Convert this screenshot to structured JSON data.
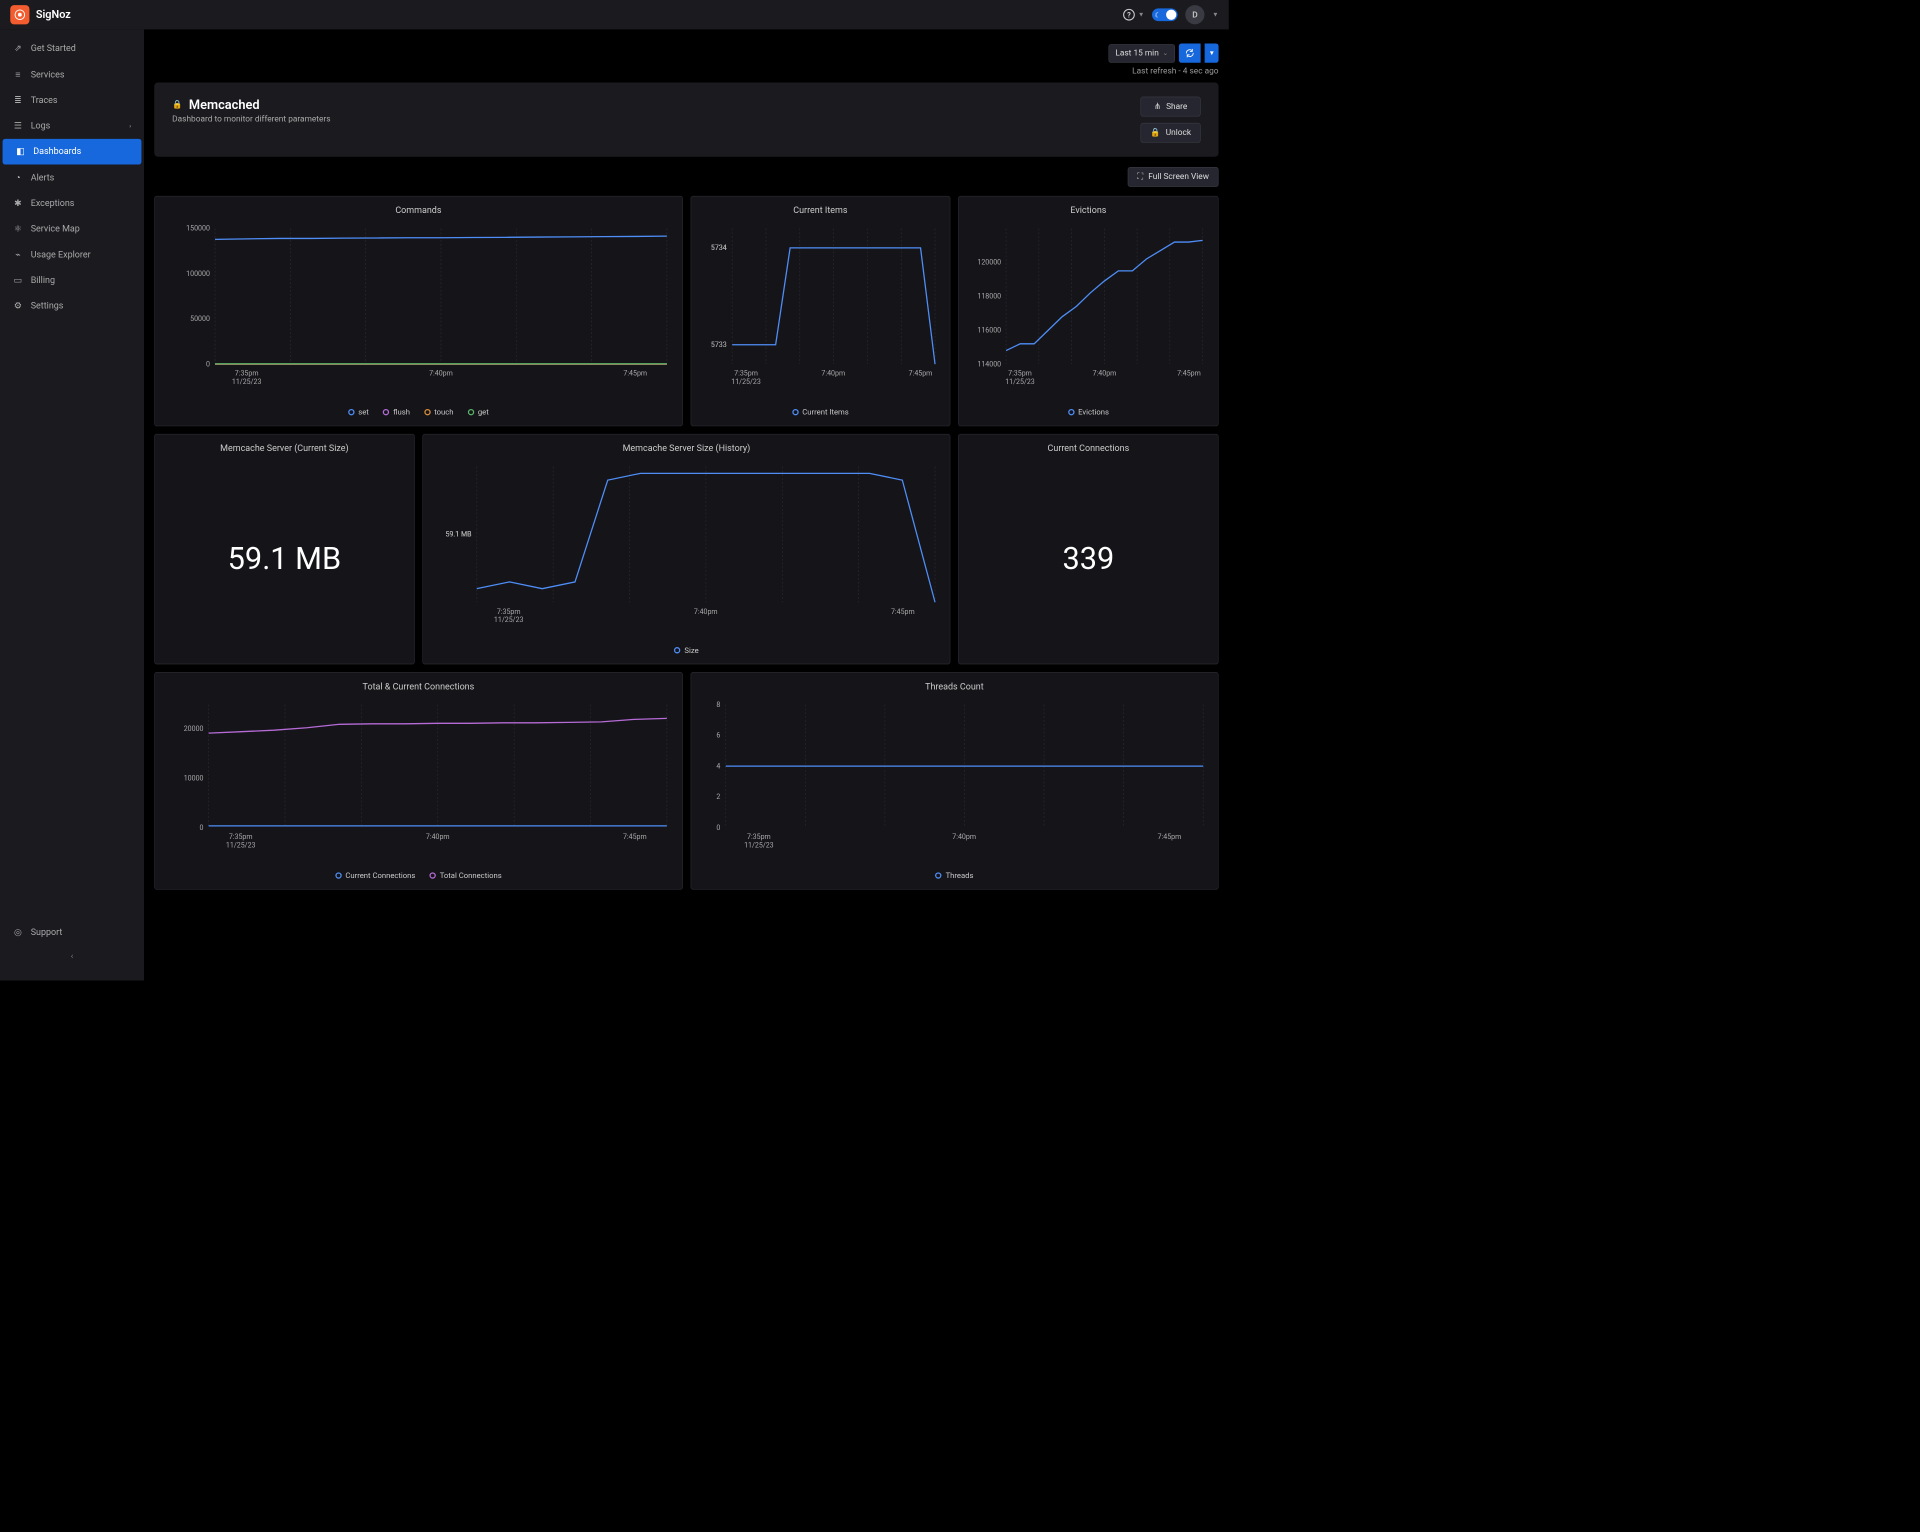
{
  "brand": {
    "name": "SigNoz"
  },
  "header": {
    "avatar_initial": "D"
  },
  "sidebar": {
    "items": [
      {
        "label": "Get Started",
        "icon": "rocket"
      },
      {
        "label": "Services",
        "icon": "bars"
      },
      {
        "label": "Traces",
        "icon": "lines"
      },
      {
        "label": "Logs",
        "icon": "list",
        "expandable": true
      },
      {
        "label": "Dashboards",
        "icon": "dashboard",
        "active": true
      },
      {
        "label": "Alerts",
        "icon": "bell"
      },
      {
        "label": "Exceptions",
        "icon": "bug"
      },
      {
        "label": "Service Map",
        "icon": "graph"
      },
      {
        "label": "Usage Explorer",
        "icon": "chart"
      },
      {
        "label": "Billing",
        "icon": "card"
      },
      {
        "label": "Settings",
        "icon": "gear"
      }
    ],
    "support_label": "Support"
  },
  "toolbar": {
    "time_range": "Last 15 min",
    "last_refresh": "Last refresh - 4 sec ago"
  },
  "dashboard": {
    "title": "Memcached",
    "description": "Dashboard to monitor different parameters",
    "share_label": "Share",
    "unlock_label": "Unlock",
    "fullscreen_label": "Full Screen View"
  },
  "panels": {
    "commands": {
      "title": "Commands",
      "legend": [
        "set",
        "flush",
        "touch",
        "get"
      ]
    },
    "current_items": {
      "title": "Current Items",
      "legend": [
        "Current Items"
      ]
    },
    "evictions": {
      "title": "Evictions",
      "legend": [
        "Evictions"
      ]
    },
    "server_size": {
      "title": "Memcache Server (Current Size)",
      "value": "59.1 MB"
    },
    "server_size_history": {
      "title": "Memcache Server Size (History)",
      "legend": [
        "Size"
      ]
    },
    "current_connections": {
      "title": "Current Connections",
      "value": "339"
    },
    "total_connections": {
      "title": "Total & Current Connections",
      "legend": [
        "Current Connections",
        "Total Connections"
      ]
    },
    "threads": {
      "title": "Threads Count",
      "legend": [
        "Threads"
      ]
    }
  },
  "chart_data": [
    {
      "id": "commands",
      "type": "line",
      "title": "Commands",
      "xlabel": "",
      "ylabel": "",
      "ylim": [
        0,
        150000
      ],
      "yticks": [
        0,
        50000,
        100000,
        150000
      ],
      "xticks": [
        "7:35pm\n11/25/23",
        "7:40pm",
        "7:45pm"
      ],
      "x": [
        0,
        1,
        2,
        3,
        4,
        5,
        6,
        7,
        8,
        9,
        10,
        11,
        12,
        13,
        14
      ],
      "series": [
        {
          "name": "set",
          "color": "#4f8ef7",
          "values": [
            138000,
            138500,
            139000,
            139000,
            139300,
            139500,
            139700,
            139800,
            140000,
            140200,
            140500,
            140700,
            141000,
            141200,
            141500
          ]
        },
        {
          "name": "flush",
          "color": "#b66bd6",
          "values": [
            0,
            0,
            0,
            0,
            0,
            0,
            0,
            0,
            0,
            0,
            0,
            0,
            0,
            0,
            0
          ]
        },
        {
          "name": "touch",
          "color": "#d98f3e",
          "values": [
            0,
            0,
            0,
            0,
            0,
            0,
            0,
            0,
            0,
            0,
            0,
            0,
            0,
            0,
            0
          ]
        },
        {
          "name": "get",
          "color": "#5bb36a",
          "values": [
            500,
            500,
            500,
            500,
            500,
            500,
            500,
            500,
            500,
            500,
            500,
            500,
            500,
            500,
            500
          ]
        }
      ]
    },
    {
      "id": "current_items",
      "type": "line",
      "title": "Current Items",
      "ylim": [
        5732.8,
        5734.2
      ],
      "yticks": [
        5733,
        5733,
        5734,
        5734,
        5734
      ],
      "ytick_labels": [
        "5733",
        "5733",
        "5734",
        "5734",
        "5734"
      ],
      "xticks": [
        "7:35pm\n11/25/23",
        "7:40pm",
        "7:45pm"
      ],
      "x": [
        0,
        1,
        2,
        3,
        4,
        5,
        6,
        7,
        8,
        9,
        10,
        11,
        12,
        13,
        14
      ],
      "series": [
        {
          "name": "Current Items",
          "color": "#4f8ef7",
          "values": [
            5733,
            5733,
            5733,
            5733,
            5734,
            5734,
            5734,
            5734,
            5734,
            5734,
            5734,
            5734,
            5734,
            5734,
            5732.8
          ]
        }
      ]
    },
    {
      "id": "evictions",
      "type": "line",
      "title": "Evictions",
      "ylim": [
        114000,
        122000
      ],
      "yticks": [
        114000,
        116000,
        118000,
        120000
      ],
      "xticks": [
        "7:35pm\n11/25/23",
        "7:40pm",
        "7:45pm"
      ],
      "x": [
        0,
        1,
        2,
        3,
        4,
        5,
        6,
        7,
        8,
        9,
        10,
        11,
        12,
        13,
        14
      ],
      "series": [
        {
          "name": "Evictions",
          "color": "#4f8ef7",
          "values": [
            114800,
            115200,
            115200,
            116000,
            116800,
            117400,
            118200,
            118900,
            119500,
            119500,
            120200,
            120700,
            121200,
            121200,
            121300
          ]
        }
      ]
    },
    {
      "id": "server_size_history",
      "type": "line",
      "title": "Memcache Server Size (History)",
      "ylim": [
        59.05,
        59.15
      ],
      "yticks": [
        59.1,
        59.1,
        59.1
      ],
      "ytick_labels": [
        "59.1 MB",
        "59.1 MB",
        "59.1 MB"
      ],
      "xticks": [
        "7:35pm\n11/25/23",
        "7:40pm",
        "7:45pm"
      ],
      "x": [
        0,
        1,
        2,
        3,
        4,
        5,
        6,
        7,
        8,
        9,
        10,
        11,
        12,
        13,
        14
      ],
      "series": [
        {
          "name": "Size",
          "color": "#4f8ef7",
          "values": [
            59.06,
            59.065,
            59.06,
            59.065,
            59.14,
            59.145,
            59.145,
            59.145,
            59.145,
            59.145,
            59.145,
            59.145,
            59.145,
            59.14,
            59.05
          ]
        }
      ]
    },
    {
      "id": "total_connections",
      "type": "line",
      "title": "Total & Current Connections",
      "ylim": [
        0,
        25000
      ],
      "yticks": [
        0,
        10000,
        20000
      ],
      "xticks": [
        "7:35pm\n11/25/23",
        "7:40pm",
        "7:45pm"
      ],
      "x": [
        0,
        1,
        2,
        3,
        4,
        5,
        6,
        7,
        8,
        9,
        10,
        11,
        12,
        13,
        14
      ],
      "series": [
        {
          "name": "Current Connections",
          "color": "#4f8ef7",
          "values": [
            339,
            339,
            339,
            339,
            339,
            339,
            339,
            339,
            339,
            339,
            339,
            339,
            339,
            339,
            339
          ]
        },
        {
          "name": "Total Connections",
          "color": "#b66bd6",
          "values": [
            19200,
            19500,
            19800,
            20300,
            21000,
            21100,
            21100,
            21200,
            21200,
            21300,
            21300,
            21400,
            21500,
            22000,
            22200
          ]
        }
      ]
    },
    {
      "id": "threads",
      "type": "line",
      "title": "Threads Count",
      "ylim": [
        0,
        8
      ],
      "yticks": [
        0,
        2,
        4,
        6,
        8
      ],
      "xticks": [
        "7:35pm\n11/25/23",
        "7:40pm",
        "7:45pm"
      ],
      "x": [
        0,
        1,
        2,
        3,
        4,
        5,
        6,
        7,
        8,
        9,
        10,
        11,
        12,
        13,
        14
      ],
      "series": [
        {
          "name": "Threads",
          "color": "#4f8ef7",
          "values": [
            4,
            4,
            4,
            4,
            4,
            4,
            4,
            4,
            4,
            4,
            4,
            4,
            4,
            4,
            4
          ]
        }
      ]
    }
  ]
}
